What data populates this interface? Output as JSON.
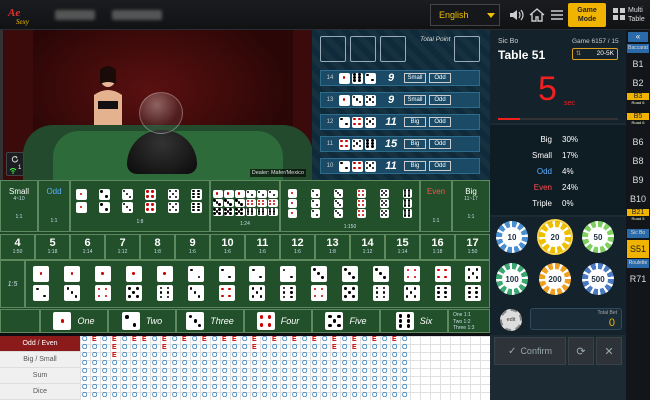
{
  "topbar": {
    "language": "English",
    "game_mode_label": "Game Mode",
    "multi_table_label": "Multi Table"
  },
  "video": {
    "dealer_label": "Dealer: Mafer/Mexico",
    "viewer_count": "1"
  },
  "history": {
    "total_point_label": "Total Point",
    "rows": [
      {
        "game": "14",
        "dice": [
          1,
          6,
          2
        ],
        "total": "9",
        "size": "Small",
        "parity": "Odd"
      },
      {
        "game": "13",
        "dice": [
          1,
          3,
          5
        ],
        "total": "9",
        "size": "Small",
        "parity": "Odd"
      },
      {
        "game": "12",
        "dice": [
          2,
          4,
          5
        ],
        "total": "11",
        "size": "Big",
        "parity": "Odd"
      },
      {
        "game": "11",
        "dice": [
          4,
          5,
          6
        ],
        "total": "15",
        "size": "Big",
        "parity": "Odd"
      },
      {
        "game": "10",
        "dice": [
          2,
          4,
          5
        ],
        "total": "11",
        "size": "Big",
        "parity": "Odd"
      }
    ]
  },
  "board": {
    "small_label": "Small",
    "small_range": "4~10",
    "small_payout": "1:1",
    "odd_label": "Odd",
    "odd_payout": "1:1",
    "even_label": "Even",
    "even_payout": "1:1",
    "big_label": "Big",
    "big_range": "11~17",
    "big_payout": "1:1",
    "doubles_payout": "1:8",
    "any_triple_payout": "1:24",
    "triples_payout": "1:150",
    "numbers": [
      {
        "n": "4",
        "p": "1:50"
      },
      {
        "n": "5",
        "p": "1:18"
      },
      {
        "n": "6",
        "p": "1:14"
      },
      {
        "n": "7",
        "p": "1:12"
      },
      {
        "n": "8",
        "p": "1:8"
      },
      {
        "n": "9",
        "p": "1:6"
      },
      {
        "n": "10",
        "p": "1:6"
      },
      {
        "n": "11",
        "p": "1:6"
      },
      {
        "n": "12",
        "p": "1:6"
      },
      {
        "n": "13",
        "p": "1:8"
      },
      {
        "n": "14",
        "p": "1:12"
      },
      {
        "n": "15",
        "p": "1:14"
      },
      {
        "n": "16",
        "p": "1:18"
      },
      {
        "n": "17",
        "p": "1:50"
      }
    ],
    "combo_payout": "1:5",
    "singles": [
      "One",
      "Two",
      "Three",
      "Four",
      "Five",
      "Six"
    ],
    "single_payout_lines": [
      "One 1:1",
      "Two 1:2",
      "Three 1:3"
    ]
  },
  "roadmap": {
    "labels": [
      "Odd / Even",
      "Big / Small",
      "Sum",
      "Dice"
    ]
  },
  "panel": {
    "game_name": "Sic Bo",
    "table_name": "Table 51",
    "game_label": "Game 6157 / 15",
    "limit": "20-5K",
    "countdown": "5",
    "countdown_unit": "sec",
    "stats": [
      {
        "k": "Big",
        "v": "30%",
        "color": "#ffffff"
      },
      {
        "k": "Small",
        "v": "17%",
        "color": "#ffffff"
      },
      {
        "k": "Odd",
        "v": "4%",
        "color": "#5ab0ff"
      },
      {
        "k": "Even",
        "v": "24%",
        "color": "#ff5050"
      },
      {
        "k": "Triple",
        "v": "0%",
        "color": "#ffffff"
      }
    ],
    "chips": [
      "10",
      "20",
      "50",
      "100",
      "200",
      "500"
    ],
    "chip_extra": "edit",
    "total_bet_label": "Total Bet",
    "total_bet_value": "0",
    "confirm_label": "Confirm"
  },
  "tables": [
    {
      "name": "Baccarat",
      "kind": "header"
    },
    {
      "name": "B1"
    },
    {
      "name": "B2"
    },
    {
      "name": "B3",
      "road": "Road 6",
      "flag": true
    },
    {
      "name": "B5",
      "road": "Road 6",
      "flag": true
    },
    {
      "name": "B6"
    },
    {
      "name": "B8"
    },
    {
      "name": "B9"
    },
    {
      "name": "B10"
    },
    {
      "name": "B21",
      "road": "Road 5",
      "flag": true
    },
    {
      "name": "Sic Bo",
      "kind": "header"
    },
    {
      "name": "S51",
      "active": true
    },
    {
      "name": "Roulette",
      "kind": "header"
    },
    {
      "name": "R71"
    }
  ]
}
